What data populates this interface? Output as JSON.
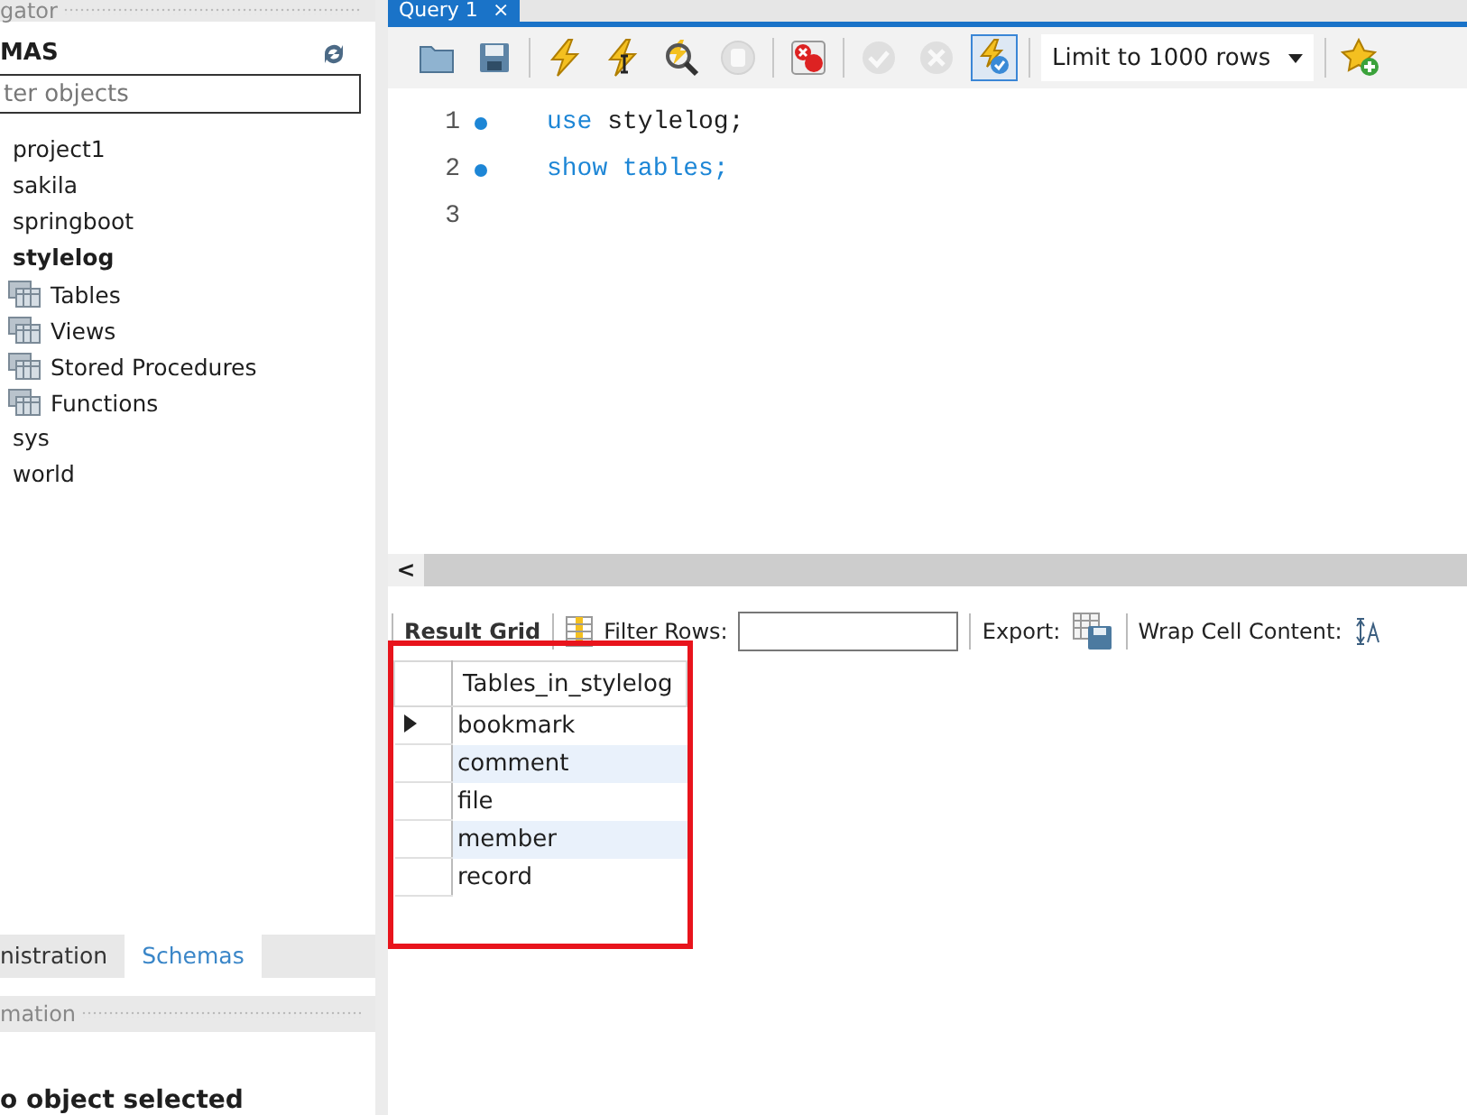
{
  "navigator": {
    "title": "gator",
    "schemas_title": "MAS",
    "filter": {
      "placeholder": "ter objects"
    },
    "tree": [
      {
        "label": "project1",
        "active": false
      },
      {
        "label": "sakila",
        "active": false
      },
      {
        "label": "springboot",
        "active": false
      },
      {
        "label": "stylelog",
        "active": true,
        "children": [
          {
            "label": "Tables"
          },
          {
            "label": "Views"
          },
          {
            "label": "Stored Procedures"
          },
          {
            "label": "Functions"
          }
        ]
      },
      {
        "label": "sys",
        "active": false
      },
      {
        "label": "world",
        "active": false
      }
    ],
    "tabs": [
      {
        "label": "nistration",
        "selected": false
      },
      {
        "label": "Schemas",
        "selected": true
      }
    ],
    "info_title": "mation",
    "info_text": "o object selected"
  },
  "editor": {
    "tab": {
      "label": "Query 1",
      "close": "×"
    },
    "toolbar": [
      {
        "kind": "open",
        "disabled": false,
        "selected": false
      },
      {
        "kind": "save",
        "disabled": false,
        "selected": false
      },
      {
        "kind": "sep"
      },
      {
        "kind": "execute",
        "disabled": false,
        "selected": false
      },
      {
        "kind": "execute-current",
        "disabled": false,
        "selected": false
      },
      {
        "kind": "explain",
        "disabled": false,
        "selected": false
      },
      {
        "kind": "stop",
        "disabled": true,
        "selected": false
      },
      {
        "kind": "sep"
      },
      {
        "kind": "stop-on-error",
        "disabled": false,
        "selected": false
      },
      {
        "kind": "sep"
      },
      {
        "kind": "commit",
        "disabled": true,
        "selected": false
      },
      {
        "kind": "rollback",
        "disabled": true,
        "selected": false
      },
      {
        "kind": "autocommit",
        "disabled": false,
        "selected": true
      },
      {
        "kind": "sep"
      },
      {
        "kind": "limit",
        "label": "Limit to 1000 rows"
      },
      {
        "kind": "sep"
      },
      {
        "kind": "snippet",
        "disabled": false,
        "selected": false
      }
    ],
    "lines": [
      {
        "number": "1",
        "marker": true,
        "tokens": [
          {
            "text": "use",
            "kind": "keyword"
          },
          {
            "text": "stylelog;",
            "kind": "plain"
          }
        ]
      },
      {
        "number": "2",
        "marker": true,
        "tokens": [
          {
            "text": "show",
            "kind": "keyword"
          },
          {
            "text": "tables;",
            "kind": "keyword"
          }
        ]
      },
      {
        "number": "3",
        "marker": false
      }
    ],
    "scroll_left": "<"
  },
  "result": {
    "toolbar": {
      "grid_label": "Result Grid",
      "filter_label": "Filter Rows:",
      "export_label": "Export:",
      "wrap_label": "Wrap Cell Content:"
    },
    "column": "Tables_in_stylelog",
    "rows": [
      {
        "value": "bookmark",
        "selected": true
      },
      {
        "value": "comment",
        "selected": false
      },
      {
        "value": "file",
        "selected": false
      },
      {
        "value": "member",
        "selected": false
      },
      {
        "value": "record",
        "selected": false
      }
    ]
  }
}
